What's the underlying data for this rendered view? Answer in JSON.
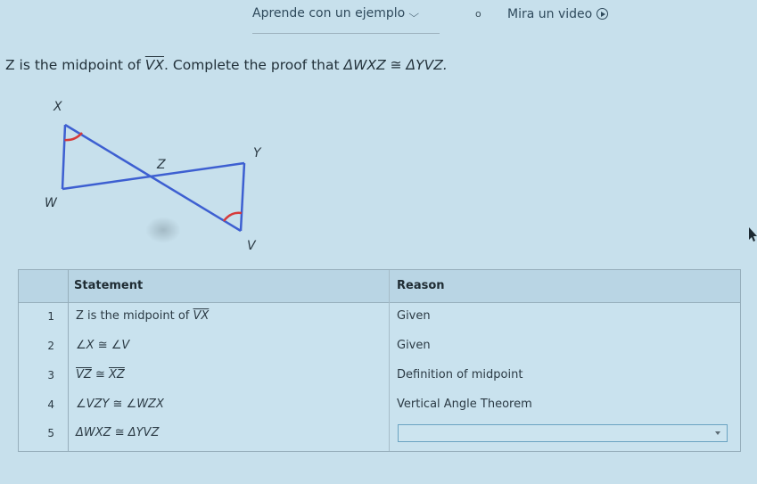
{
  "header": {
    "example_link": "Aprende con un ejemplo",
    "separator": "o",
    "video_link": "Mira un video"
  },
  "problem": {
    "prefix": "Z is the midpoint of ",
    "segment": "VX",
    "middle": ". Complete the proof that ",
    "congruence": "ΔWXZ ≅ ΔYVZ."
  },
  "diagram": {
    "labels": {
      "X": "X",
      "W": "W",
      "Z": "Z",
      "Y": "Y",
      "V": "V"
    },
    "line_color": "#3d5fd1",
    "angle_mark_color": "#d63a3a"
  },
  "table": {
    "headers": {
      "statement": "Statement",
      "reason": "Reason"
    },
    "rows": [
      {
        "num": "1",
        "statement_pre": "Z is the midpoint of ",
        "statement_seg": "VX",
        "reason": "Given"
      },
      {
        "num": "2",
        "statement": "∠X ≅ ∠V",
        "reason": "Given"
      },
      {
        "num": "3",
        "seg1": "VZ",
        "cong": " ≅ ",
        "seg2": "XZ",
        "reason": "Definition of midpoint"
      },
      {
        "num": "4",
        "statement": "∠VZY ≅ ∠WZX",
        "reason": "Vertical Angle Theorem"
      },
      {
        "num": "5",
        "statement": "ΔWXZ ≅ ΔYVZ",
        "reason": ""
      }
    ]
  }
}
